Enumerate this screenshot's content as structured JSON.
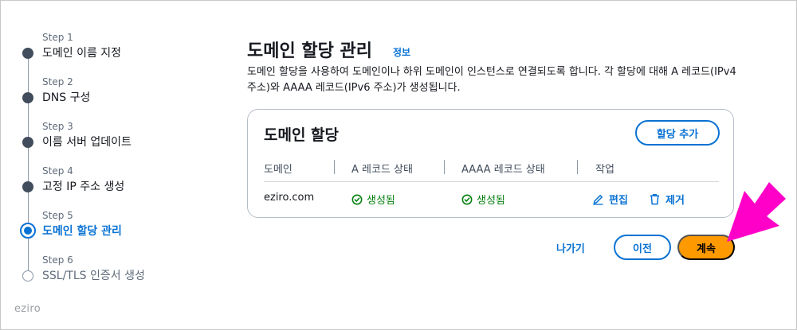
{
  "steps": [
    {
      "label": "Step 1",
      "title": "도메인 이름 지정",
      "state": "done"
    },
    {
      "label": "Step 2",
      "title": "DNS 구성",
      "state": "done"
    },
    {
      "label": "Step 3",
      "title": "이름 서버 업데이트",
      "state": "done"
    },
    {
      "label": "Step 4",
      "title": "고정 IP 주소 생성",
      "state": "done"
    },
    {
      "label": "Step 5",
      "title": "도메인 할당 관리",
      "state": "active"
    },
    {
      "label": "Step 6",
      "title": "SSL/TLS 인증서 생성",
      "state": "pending"
    }
  ],
  "brand": "eziro",
  "page": {
    "title": "도메인 할당 관리",
    "info_link": "정보",
    "description": "도메인 할당을 사용하여 도메인이나 하위 도메인이 인스턴스로 연결되도록 합니다. 각 할당에 대해 A 레코드(IPv4 주소)와 AAAA 레코드(IPv6 주소)가 생성됩니다."
  },
  "card": {
    "title": "도메인 할당",
    "add_button": "할당 추가",
    "columns": [
      "도메인",
      "A 레코드 상태",
      "AAAA 레코드 상태",
      "작업"
    ],
    "rows": [
      {
        "domain": "eziro.com",
        "a_status": "생성됨",
        "aaaa_status": "생성됨",
        "edit": "편집",
        "remove": "제거"
      }
    ]
  },
  "footer": {
    "cancel": "나가기",
    "previous": "이전",
    "next": "계속"
  },
  "colors": {
    "accent": "#0972d3",
    "primary_button": "#ff9900",
    "success": "#037f0c",
    "annotation_arrow": "#ff00c8"
  },
  "icons": {
    "status": "check-circle-icon",
    "edit": "pencil-icon",
    "remove": "trash-icon"
  }
}
